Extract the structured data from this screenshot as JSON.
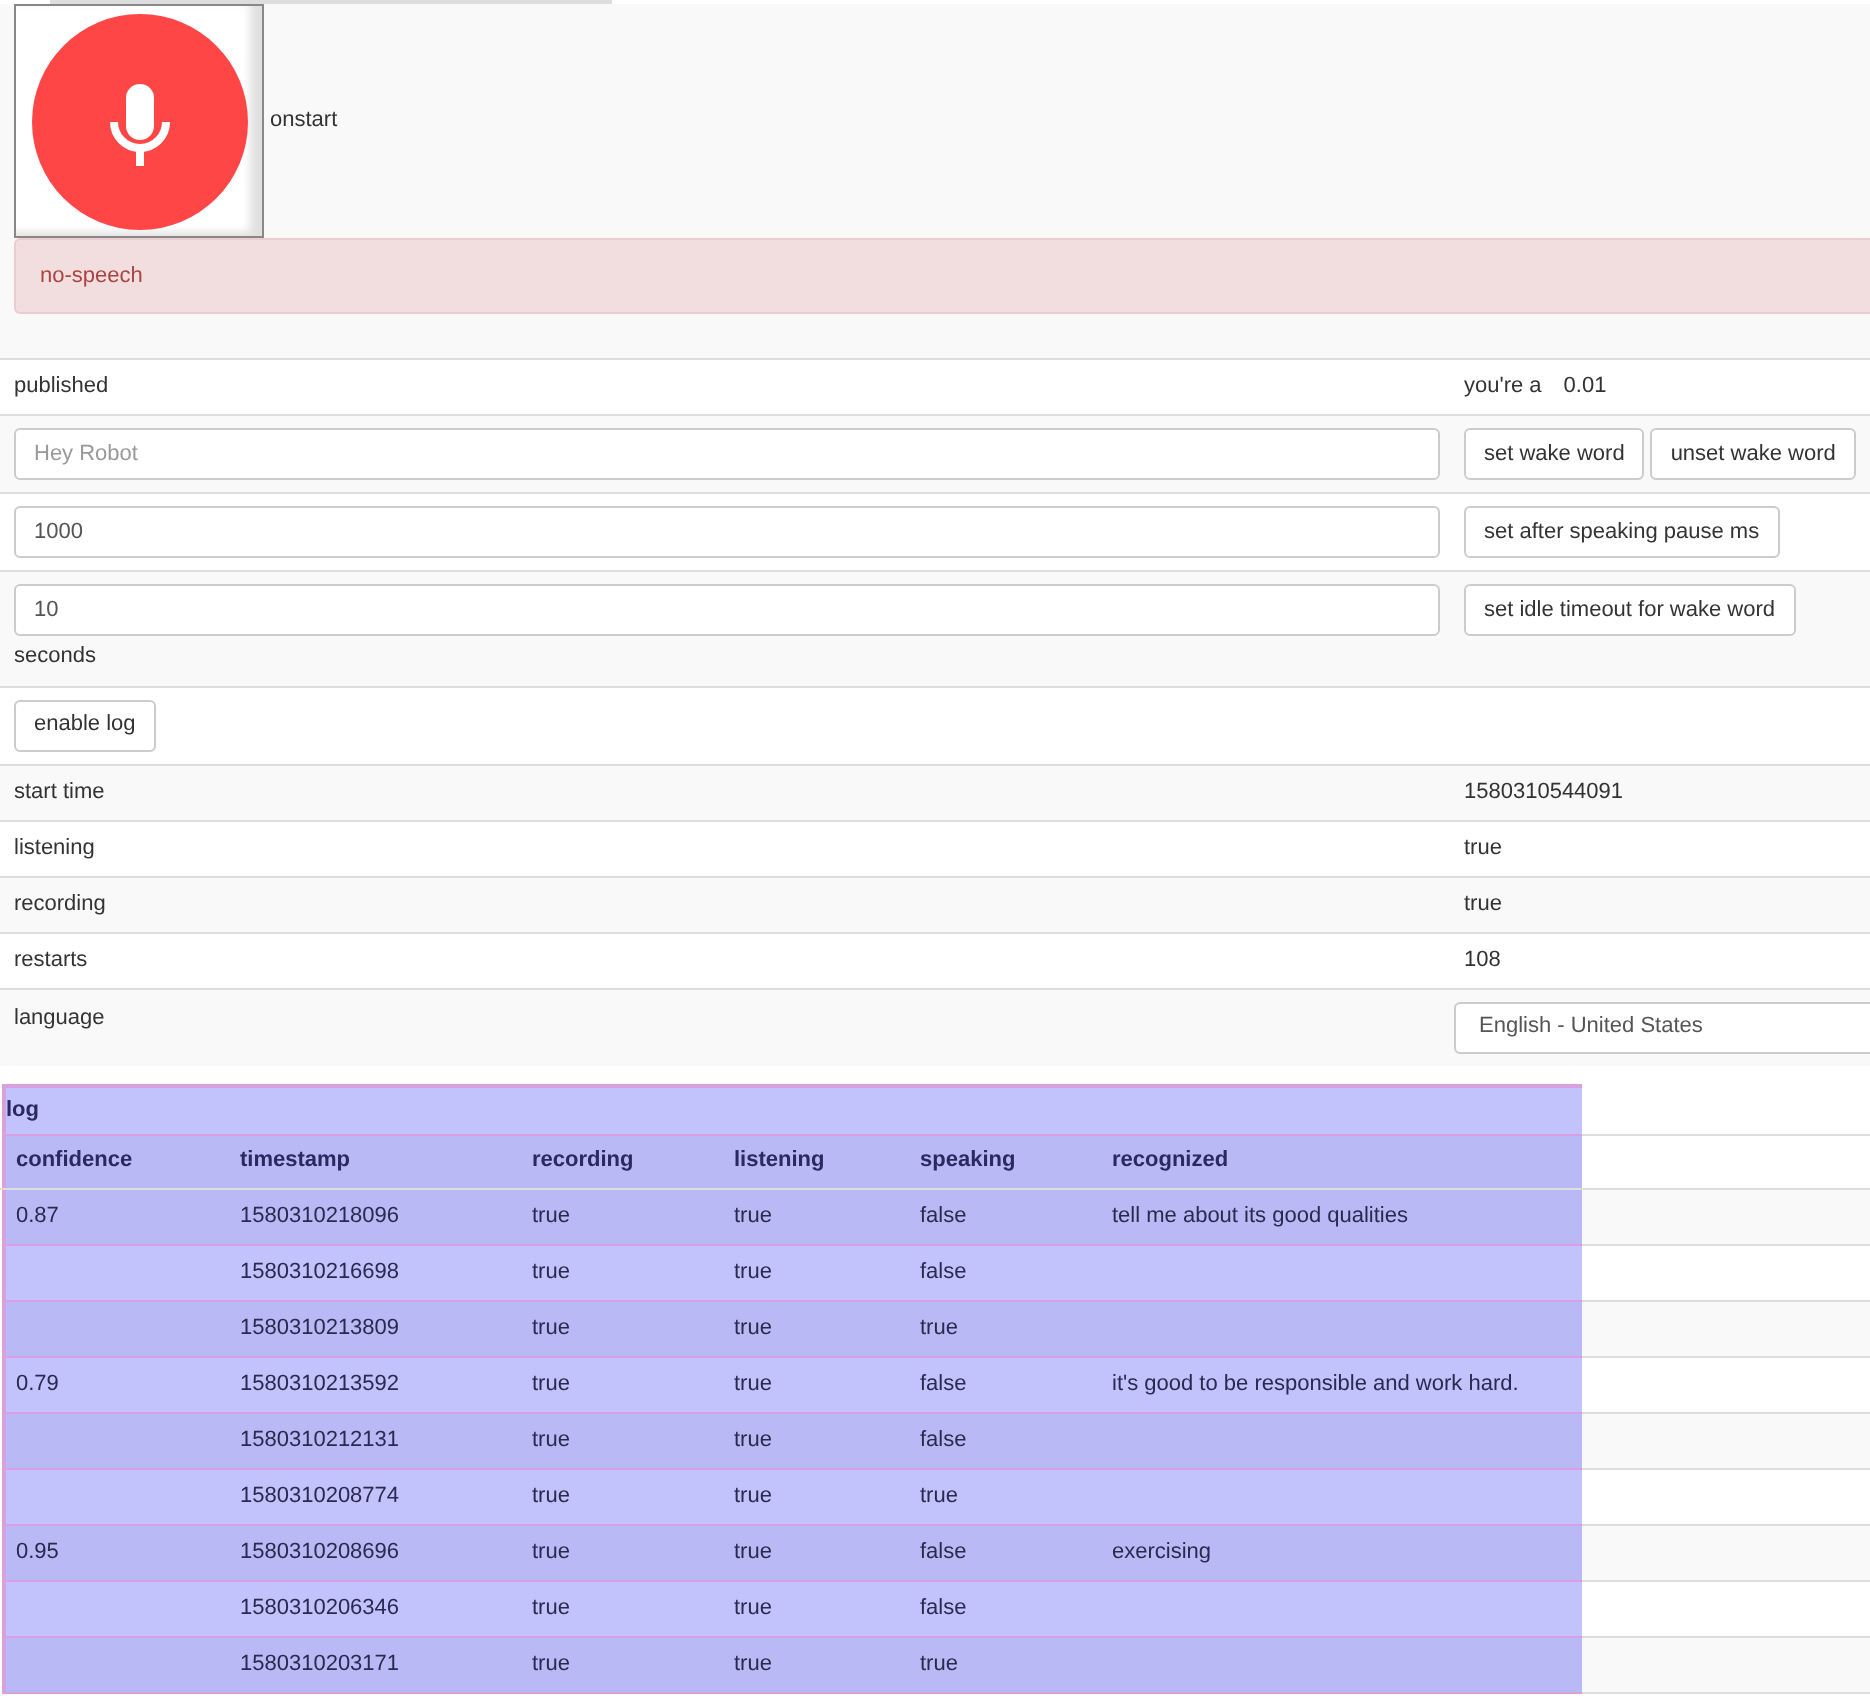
{
  "event": "onstart",
  "alert": "no-speech",
  "published": {
    "label": "published",
    "prefix": "you're a",
    "value": "0.01"
  },
  "settings": [
    {
      "placeholder": "Hey Robot",
      "buttons": [
        "set wake word",
        "unset wake word"
      ]
    },
    {
      "value": "1000",
      "buttons": [
        "set after speaking pause ms"
      ]
    },
    {
      "value": "10",
      "unit": "seconds",
      "buttons": [
        "set idle timeout for wake word"
      ]
    }
  ],
  "enable_log": "enable log",
  "info": [
    {
      "label": "start time",
      "value": "1580310544091"
    },
    {
      "label": "listening",
      "value": "true"
    },
    {
      "label": "recording",
      "value": "true"
    },
    {
      "label": "restarts",
      "value": "108"
    }
  ],
  "language": {
    "label": "language",
    "value": "English - United States"
  },
  "log": {
    "caption": "log",
    "columns": [
      "confidence",
      "timestamp",
      "recording",
      "listening",
      "speaking",
      "recognized"
    ],
    "rows": [
      [
        "0.87",
        "1580310218096",
        "true",
        "true",
        "false",
        "tell me about its good qualities"
      ],
      [
        "",
        "1580310216698",
        "true",
        "true",
        "false",
        ""
      ],
      [
        "",
        "1580310213809",
        "true",
        "true",
        "true",
        ""
      ],
      [
        "0.79",
        "1580310213592",
        "true",
        "true",
        "false",
        "it's good to be responsible and work hard."
      ],
      [
        "",
        "1580310212131",
        "true",
        "true",
        "false",
        ""
      ],
      [
        "",
        "1580310208774",
        "true",
        "true",
        "true",
        ""
      ],
      [
        "0.95",
        "1580310208696",
        "true",
        "true",
        "false",
        "exercising"
      ],
      [
        "",
        "1580310206346",
        "true",
        "true",
        "false",
        ""
      ],
      [
        "",
        "1580310203171",
        "true",
        "true",
        "true",
        ""
      ]
    ]
  }
}
